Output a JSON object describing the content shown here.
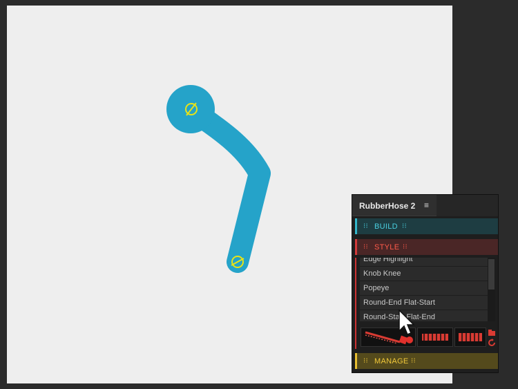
{
  "panel": {
    "title": "RubberHose 2",
    "menu_glyph": "≡",
    "sections": {
      "build": "BUILD",
      "style": "STYLE",
      "manage": "MANAGE"
    },
    "style_list": [
      "Edge Highlight",
      "Knob Knee",
      "Popeye",
      "Round-End Flat-Start",
      "Round-Start Flat-End"
    ]
  },
  "colors": {
    "hose": "#25a3c9",
    "controller": "#e8e317",
    "build_accent": "#33b7cb",
    "style_accent": "#d23b3b",
    "manage_accent": "#e8be30"
  },
  "icons": [
    "crosshair-icon",
    "menu-icon",
    "grip-icon",
    "hose-preset-icon",
    "refresh-icon",
    "folder-icon",
    "pointer-cursor-icon"
  ]
}
